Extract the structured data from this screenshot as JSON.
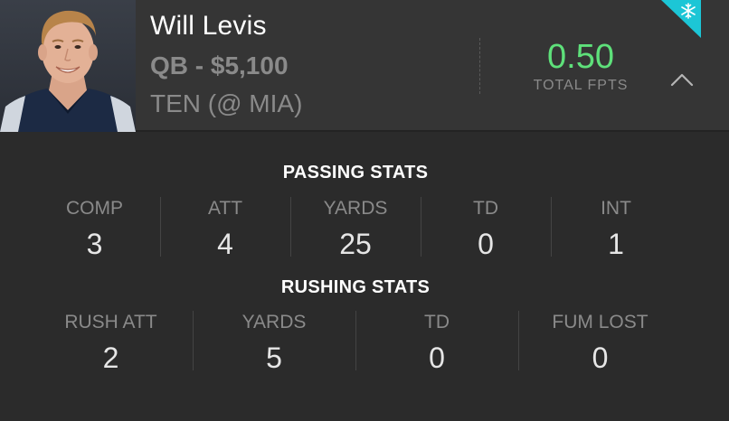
{
  "player": {
    "name": "Will Levis",
    "position_price": "QB - $5,100",
    "matchup": "TEN (@ MIA)",
    "photo": "player-headshot"
  },
  "fpts": {
    "value": "0.50",
    "label": "TOTAL FPTS",
    "color": "#5ee07a"
  },
  "icons": {
    "collapse": "chevron-up-icon",
    "corner": "snowflake-icon"
  },
  "colors": {
    "accent_corner": "#1cc6d6",
    "background": "#2b2b2b",
    "header_background": "#353535"
  },
  "passing": {
    "title": "PASSING STATS",
    "stats": [
      {
        "label": "COMP",
        "value": "3"
      },
      {
        "label": "ATT",
        "value": "4"
      },
      {
        "label": "YARDS",
        "value": "25"
      },
      {
        "label": "TD",
        "value": "0"
      },
      {
        "label": "INT",
        "value": "1"
      }
    ]
  },
  "rushing": {
    "title": "RUSHING STATS",
    "stats": [
      {
        "label": "RUSH ATT",
        "value": "2"
      },
      {
        "label": "YARDS",
        "value": "5"
      },
      {
        "label": "TD",
        "value": "0"
      },
      {
        "label": "FUM LOST",
        "value": "0"
      }
    ]
  }
}
